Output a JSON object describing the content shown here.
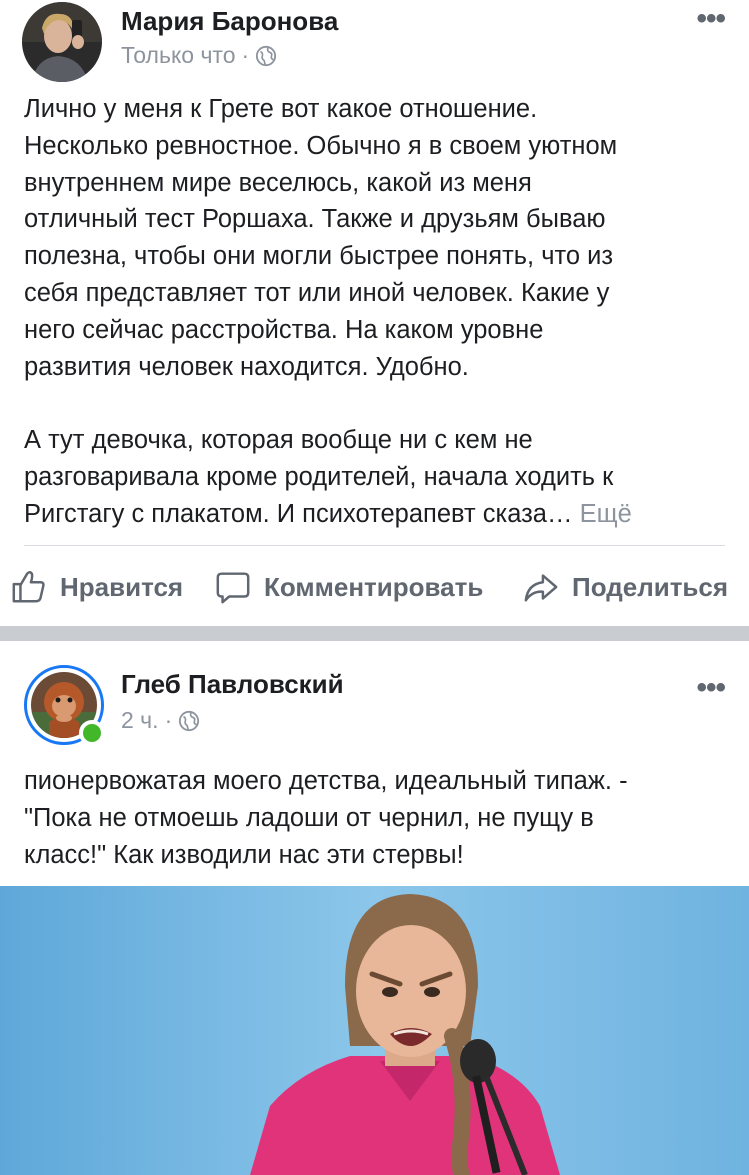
{
  "posts": [
    {
      "author": "Мария Баронова",
      "time": "Только что",
      "separator": "·",
      "text_lines": [
        "Лично у меня к Грете вот какое отношение.",
        "Несколько ревностное. Обычно я в своем уютном",
        "внутреннем мире веселюсь, какой из меня",
        "отличный тест Роршаха. Также и друзьям бываю",
        "полезна, чтобы они могли быстрее понять, что из",
        "себя представляет тот или иной человек. Какие у",
        "него сейчас расстройства. На каком уровне",
        "развития человек находится. Удобно."
      ],
      "text_lines_2": [
        "А тут девочка, которая вообще ни с кем не",
        "разговаривала кроме родителей, начала ходить к",
        "Ригстагу с плакатом. И психотерапевт сказа…"
      ],
      "see_more": "Ещё",
      "actions": {
        "like": "Нравится",
        "comment": "Комментировать",
        "share": "Поделиться"
      }
    },
    {
      "author": "Глеб Павловский",
      "time": "2 ч.",
      "separator": "·",
      "text_lines": [
        "пионервожатая моего детства, идеальный типаж. -",
        "\"Пока не отмоешь ладоши от чернил, не пущу в",
        "класс!\" Как изводили нас эти стервы!"
      ]
    }
  ],
  "icons": {
    "more": "more-horizontal-icon",
    "privacy": "globe-icon",
    "like": "thumbs-up-icon",
    "comment": "comment-bubble-icon",
    "share": "share-arrow-icon"
  },
  "colors": {
    "link_blue": "#1877f2",
    "online_green": "#42b72a",
    "secondary_text": "#8d949e",
    "action_text": "#606770",
    "separator": "#c9ccd1"
  }
}
